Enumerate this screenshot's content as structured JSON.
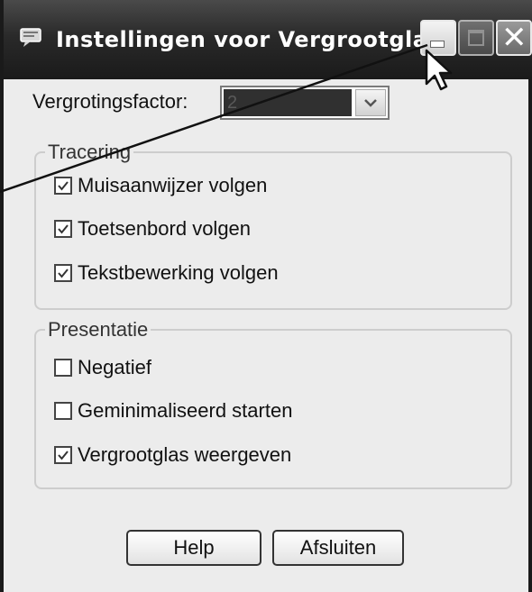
{
  "window": {
    "title": "Instellingen voor Vergrootglas",
    "icon": "magnifier-app-icon"
  },
  "titlebar_buttons": {
    "minimize": "minimize-icon",
    "maximize": "maximize-icon",
    "close": "close-icon"
  },
  "zoom": {
    "label": "Vergrotingsfactor:",
    "value": "2"
  },
  "tracking": {
    "legend": "Tracering",
    "options": [
      {
        "label": "Muisaanwijzer volgen",
        "checked": true
      },
      {
        "label": "Toetsenbord volgen",
        "checked": true
      },
      {
        "label": "Tekstbewerking volgen",
        "checked": true
      }
    ]
  },
  "presentation": {
    "legend": "Presentatie",
    "options": [
      {
        "label": "Negatief",
        "checked": false
      },
      {
        "label": "Geminimaliseerd starten",
        "checked": false
      },
      {
        "label": "Vergrootglas weergeven",
        "checked": true
      }
    ]
  },
  "buttons": {
    "help": "Help",
    "close": "Afsluiten"
  },
  "colors": {
    "titlebar": "#2a2a2a",
    "dialog_bg": "#ececec"
  }
}
